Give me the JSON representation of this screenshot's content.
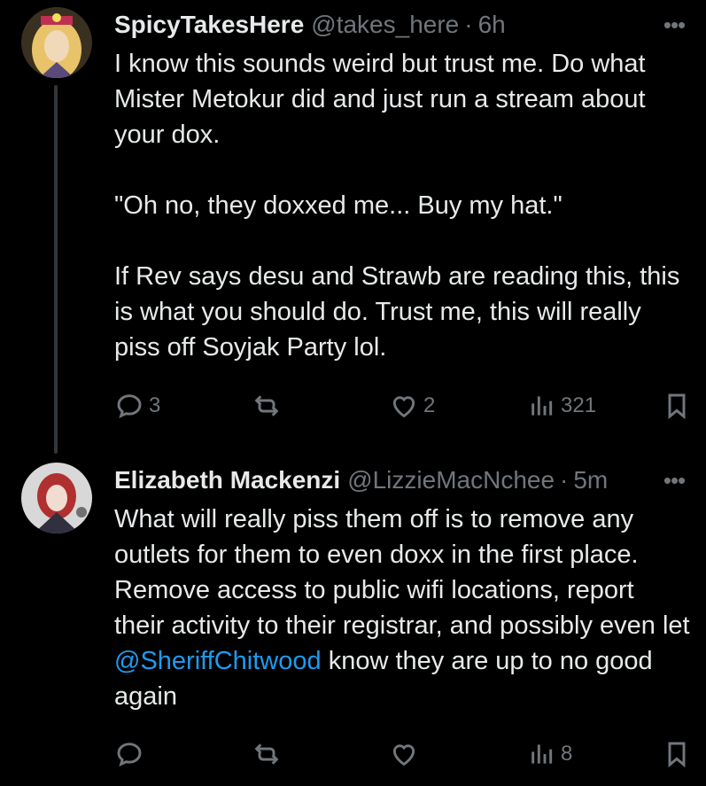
{
  "tweets": [
    {
      "name": "SpicyTakesHere",
      "handle": "@takes_here",
      "dot": "·",
      "time": "6h",
      "more": "•••",
      "text": {
        "p1": "I know this sounds weird but trust me. Do what Mister Metokur did and just run a stream about your dox.",
        "p2": "\"Oh no, they doxxed me... Buy my hat.\"",
        "p3": "If Rev says desu and Strawb are reading this, this is what you should do. Trust me, this will really piss off Soyjak Party lol."
      },
      "replies": "3",
      "retweets": "",
      "likes": "2",
      "views": "321",
      "avatar_colors": [
        "#6b5a3a",
        "#e8c36a",
        "#c03050"
      ]
    },
    {
      "name": "Elizabeth Mackenzi",
      "handle": "@LizzieMacNchee",
      "dot": "·",
      "time": "5m",
      "more": "•••",
      "text": {
        "before": "What will really piss them off is to remove any outlets for them to even doxx in the first place. Remove access to public wifi locations, report their activity to their registrar, and possibly even let ",
        "mention": "@SheriffChitwood",
        "after": " know they are up to no good again"
      },
      "replies": "",
      "retweets": "",
      "likes": "",
      "views": "8",
      "avatar_colors": [
        "#c8c8c8",
        "#b03030",
        "#303040"
      ]
    }
  ],
  "icons": [
    "reply-icon",
    "retweet-icon",
    "like-icon",
    "views-icon",
    "bookmark-icon",
    "more-icon"
  ]
}
